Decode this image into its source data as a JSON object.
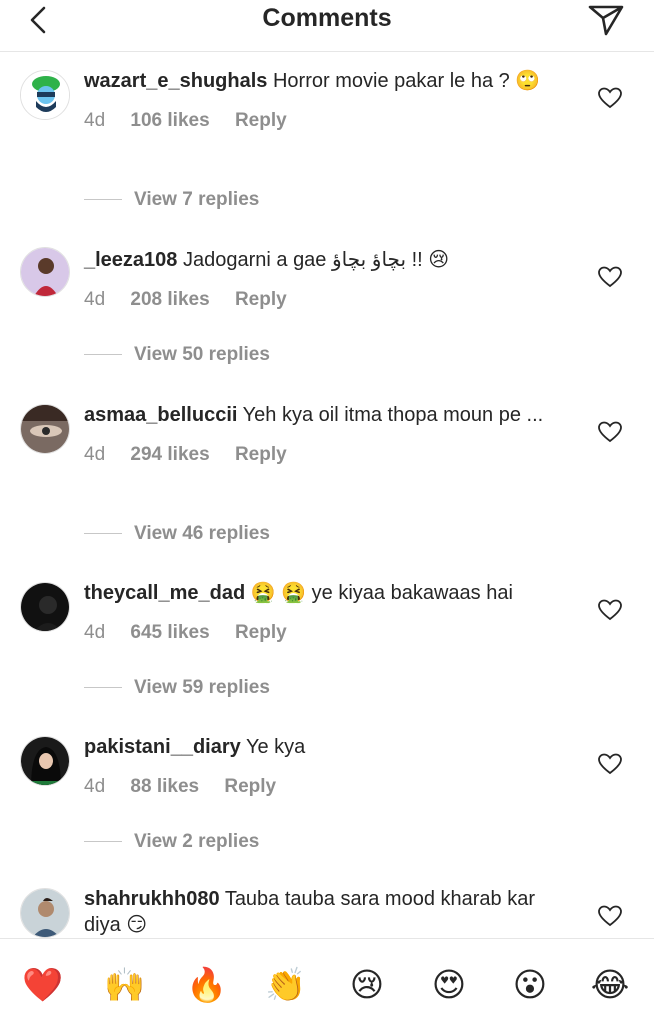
{
  "header": {
    "title": "Comments",
    "back_icon": "chevron-left-icon",
    "send_icon": "paper-plane-icon"
  },
  "comments": [
    {
      "username": "wazart_e_shughals",
      "text": "Horror movie pakar le ha ?",
      "emoji": "🙄",
      "time": "4d",
      "likes": "106 likes",
      "reply": "Reply",
      "view_replies": "View 7 replies"
    },
    {
      "username": "_leeza108",
      "text": "Jadogarni a gae بچاؤ بچاؤ !!",
      "emoji": "😢",
      "time": "4d",
      "likes": "208 likes",
      "reply": "Reply",
      "view_replies": "View 50 replies"
    },
    {
      "username": "asmaa_belluccii",
      "text": "Yeh kya oil itma thopa moun pe ...",
      "emoji": "",
      "time": "4d",
      "likes": "294 likes",
      "reply": "Reply",
      "view_replies": "View 46 replies"
    },
    {
      "username": "theycall_me_dad",
      "text": "🤮 🤮 ye kiyaa bakawaas hai",
      "emoji": "",
      "time": "4d",
      "likes": "645 likes",
      "reply": "Reply",
      "view_replies": "View 59 replies"
    },
    {
      "username": "pakistani__diary",
      "text": "Ye kya",
      "emoji": "",
      "time": "4d",
      "likes": "88 likes",
      "reply": "Reply",
      "view_replies": "View 2 replies"
    },
    {
      "username": "shahrukhh080",
      "text": "Tauba tauba sara mood kharab kar diya",
      "emoji": "😏",
      "time": "",
      "likes": "",
      "reply": "",
      "view_replies": ""
    }
  ],
  "emoji_bar": [
    "❤️",
    "🙌",
    "🔥",
    "👏",
    "😢",
    "😍",
    "😮",
    "😂"
  ],
  "colors": {
    "text": "#262626",
    "secondary": "#8e8e8e",
    "divider": "#e6e6e6",
    "heart_red": "#ed4956"
  }
}
